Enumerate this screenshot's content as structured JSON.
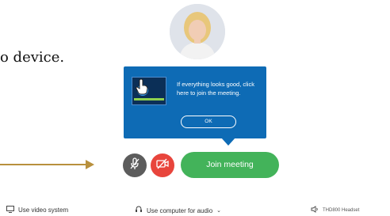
{
  "instruction": {
    "text": "o device."
  },
  "tooltip": {
    "message": "If everything looks good, click here to join the meeting.",
    "ok_label": "OK"
  },
  "controls": {
    "mute_icon": "microphone-muted-icon",
    "video_icon": "video-off-icon",
    "join_label": "Join meeting"
  },
  "bottom_bar": {
    "video_system_label": "Use video system",
    "audio_label": "Use computer for audio",
    "audio_chevron": "⌄",
    "headset_label": "THD800 Headset"
  },
  "colors": {
    "tooltip_bg": "#0e6bb5",
    "join_green": "#43b35a",
    "video_red": "#e8453c",
    "mute_gray": "#5c5c5c",
    "arrow_gold": "#b8903d"
  }
}
